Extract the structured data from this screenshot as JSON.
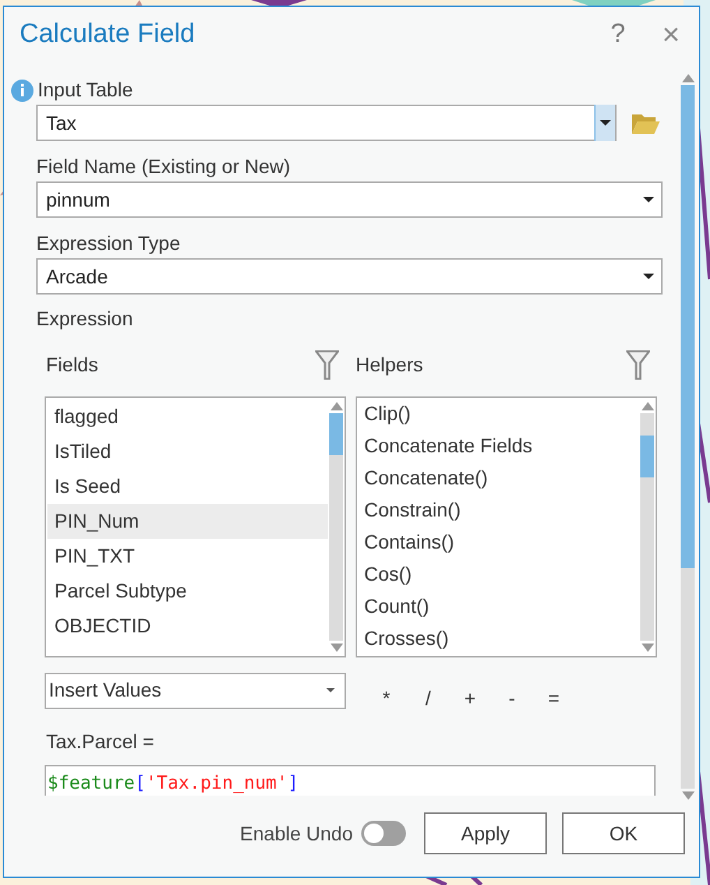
{
  "window": {
    "title": "Calculate Field",
    "help": "?",
    "close": "×"
  },
  "input_table": {
    "label": "Input Table",
    "value": "Tax"
  },
  "field_name": {
    "label": "Field Name (Existing or New)",
    "value": "pinnum"
  },
  "expression_type": {
    "label": "Expression Type",
    "value": "Arcade"
  },
  "expression": {
    "label": "Expression",
    "fields": {
      "label": "Fields",
      "items": [
        {
          "text": "flagged",
          "selected": false
        },
        {
          "text": "IsTiled",
          "selected": false
        },
        {
          "text": "Is Seed",
          "selected": false
        },
        {
          "text": "PIN_Num",
          "selected": true
        },
        {
          "text": "PIN_TXT",
          "selected": false
        },
        {
          "text": "Parcel Subtype",
          "selected": false
        },
        {
          "text": "OBJECTID",
          "selected": false
        }
      ]
    },
    "helpers": {
      "label": "Helpers",
      "items": [
        "Clip()",
        "Concatenate Fields",
        "Concatenate()",
        "Constrain()",
        "Contains()",
        "Cos()",
        "Count()",
        "Crosses()"
      ]
    },
    "insert_values": "Insert Values",
    "operators": [
      "*",
      "/",
      "+",
      "-",
      "="
    ],
    "target": "Tax.Parcel =",
    "code": [
      {
        "kind": "variable",
        "text": "$feature"
      },
      {
        "kind": "bracket",
        "text": "["
      },
      {
        "kind": "string",
        "text": "'Tax.pin_num'"
      },
      {
        "kind": "bracket",
        "text": "]"
      }
    ]
  },
  "footer": {
    "enable_undo": {
      "label": "Enable Undo",
      "on": false
    },
    "buttons": [
      "Apply",
      "OK"
    ]
  }
}
